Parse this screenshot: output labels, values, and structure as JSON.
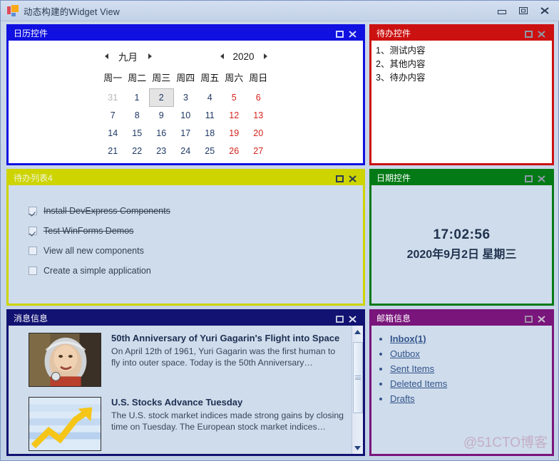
{
  "window": {
    "title": "动态构建的Widget View",
    "icon": "app-squares-icon",
    "buttons": {
      "minimize": "Minimize",
      "maximize": "Maximize",
      "close": "Close"
    }
  },
  "widget_chrome": {
    "restore": "Restore",
    "close": "Close"
  },
  "calendar_widget": {
    "title": "日历控件",
    "accent": "#1010e0",
    "month": "九月",
    "year": "2020",
    "weekdays": [
      "周一",
      "周二",
      "周三",
      "周四",
      "周五",
      "周六",
      "周日"
    ],
    "weeks": [
      [
        {
          "d": "31",
          "t": "other"
        },
        {
          "d": "1",
          "t": "day"
        },
        {
          "d": "2",
          "t": "selected"
        },
        {
          "d": "3",
          "t": "day"
        },
        {
          "d": "4",
          "t": "day"
        },
        {
          "d": "5",
          "t": "weekend"
        },
        {
          "d": "6",
          "t": "weekend"
        }
      ],
      [
        {
          "d": "7",
          "t": "day"
        },
        {
          "d": "8",
          "t": "day"
        },
        {
          "d": "9",
          "t": "day"
        },
        {
          "d": "10",
          "t": "day"
        },
        {
          "d": "11",
          "t": "day"
        },
        {
          "d": "12",
          "t": "weekend"
        },
        {
          "d": "13",
          "t": "weekend"
        }
      ],
      [
        {
          "d": "14",
          "t": "day"
        },
        {
          "d": "15",
          "t": "day"
        },
        {
          "d": "16",
          "t": "day"
        },
        {
          "d": "17",
          "t": "day"
        },
        {
          "d": "18",
          "t": "day"
        },
        {
          "d": "19",
          "t": "weekend"
        },
        {
          "d": "20",
          "t": "weekend"
        }
      ],
      [
        {
          "d": "21",
          "t": "day"
        },
        {
          "d": "22",
          "t": "day"
        },
        {
          "d": "23",
          "t": "day"
        },
        {
          "d": "24",
          "t": "day"
        },
        {
          "d": "25",
          "t": "day"
        },
        {
          "d": "26",
          "t": "weekend"
        },
        {
          "d": "27",
          "t": "weekend"
        }
      ]
    ]
  },
  "todo_widget": {
    "title": "待办控件",
    "accent": "#cc1111",
    "items": [
      "1、测试内容",
      "2、其他内容",
      "3、待办内容"
    ]
  },
  "tasks_widget": {
    "title": "待办列表4",
    "accent": "#cdd400",
    "items": [
      {
        "label": "Install DevExpress Components",
        "checked": true
      },
      {
        "label": "Test WinForms Demos",
        "checked": true
      },
      {
        "label": "View all new components",
        "checked": false
      },
      {
        "label": "Create a simple application",
        "checked": false
      }
    ]
  },
  "date_widget": {
    "title": "日期控件",
    "accent": "#047a16",
    "time": "17:02:56",
    "date": "2020年9月2日 星期三"
  },
  "news_widget": {
    "title": "消息信息",
    "accent": "#121272",
    "items": [
      {
        "thumb": "cosmonaut-photo",
        "headline": "50th Anniversary of Yuri Gagarin's Flight into Space",
        "body": "On April 12th of 1961, Yuri Gagarin was the first human to fly into outer space. Today is the 50th Anniversary…"
      },
      {
        "thumb": "stock-chart-photo",
        "headline": "U.S. Stocks Advance Tuesday",
        "body": "The U.S. stock market indices made strong gains by closing time on Tuesday. The European stock market indices…"
      }
    ],
    "scrollbar": {
      "up": "Scroll up",
      "down": "Scroll down",
      "thumb": "Scroll thumb"
    }
  },
  "mail_widget": {
    "title": "邮箱信息",
    "accent": "#79157b",
    "links": [
      {
        "label": "Inbox(1)",
        "unread": true
      },
      {
        "label": "Outbox",
        "unread": false
      },
      {
        "label": "Sent Items",
        "unread": false
      },
      {
        "label": "Deleted Items",
        "unread": false
      },
      {
        "label": "Drafts",
        "unread": false
      }
    ],
    "watermark": "@51CTO博客"
  }
}
